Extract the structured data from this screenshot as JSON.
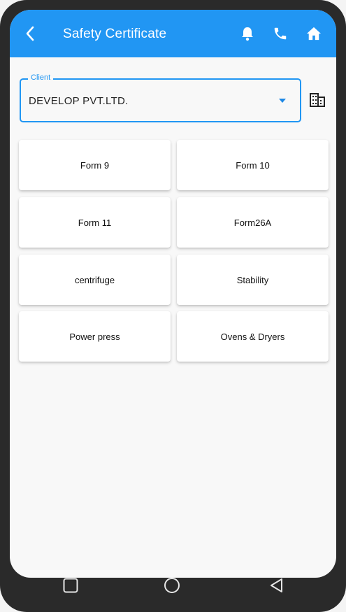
{
  "appbar": {
    "title": "Safety Certificate",
    "color": "#2196f3",
    "icons": [
      "back-arrow-icon",
      "bell-icon",
      "phone-icon",
      "home-icon"
    ]
  },
  "client": {
    "label": "Client",
    "value": "DEVELOP PVT.LTD."
  },
  "grid": {
    "items": [
      {
        "label": "Form 9"
      },
      {
        "label": "Form 10"
      },
      {
        "label": "Form 11"
      },
      {
        "label": "Form26A"
      },
      {
        "label": "centrifuge"
      },
      {
        "label": "Stability"
      },
      {
        "label": "Power press"
      },
      {
        "label": "Ovens & Dryers"
      }
    ]
  },
  "navbar": {
    "icons": [
      "recent-apps-icon",
      "home-circle-icon",
      "back-triangle-icon"
    ]
  }
}
